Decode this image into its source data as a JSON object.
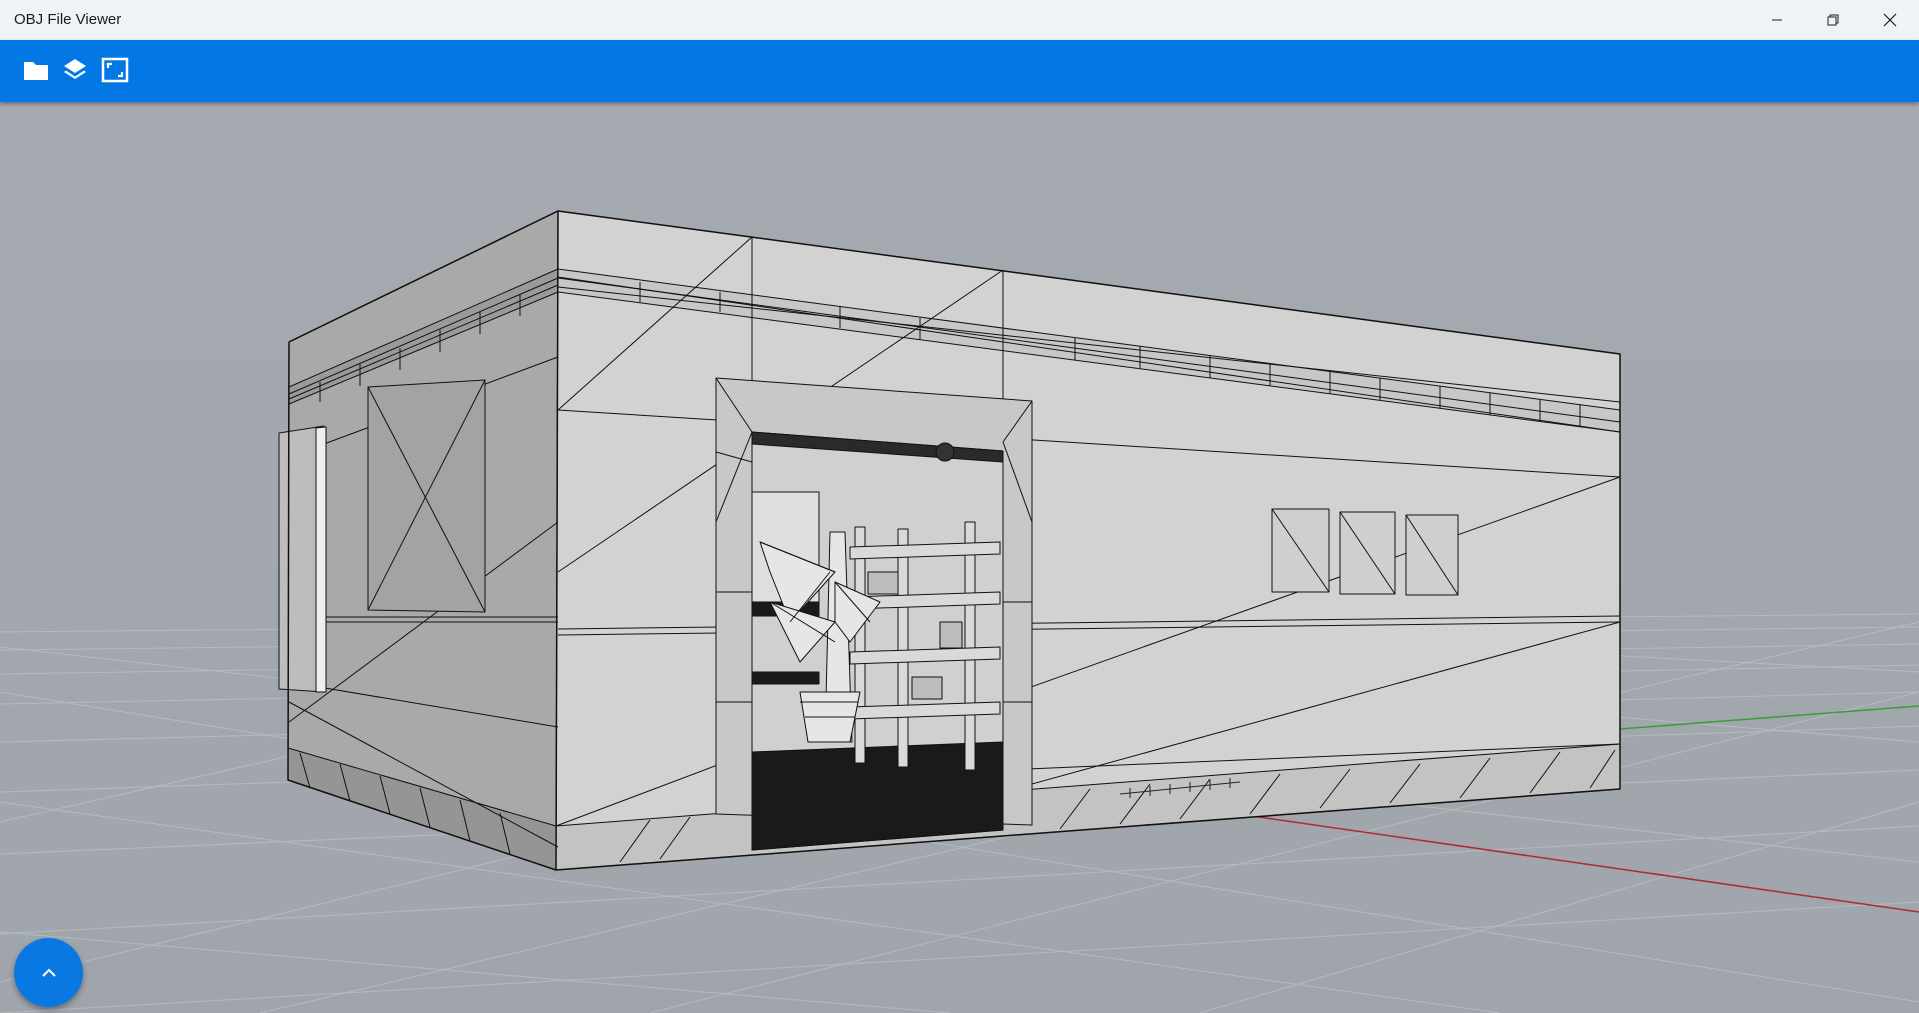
{
  "window": {
    "title": "OBJ File Viewer",
    "controls": [
      "minimize-icon",
      "restore-icon",
      "close-icon"
    ]
  },
  "toolbar": {
    "items": [
      {
        "name": "open-file-button",
        "icon": "folder-icon"
      },
      {
        "name": "layers-button",
        "icon": "layers-icon"
      },
      {
        "name": "fit-view-button",
        "icon": "fit-view-icon"
      }
    ]
  },
  "viewport": {
    "background": "#a3a8ae",
    "grid_color": "#b7bcc1",
    "axis_x_color": "#b02a2a",
    "axis_y_color": "#3c9a3c"
  },
  "fab": {
    "icon": "chevron-up-icon"
  },
  "colors": {
    "toolbar": "#0378e4",
    "titlebar": "#eff3f8",
    "fab": "#0a78e2"
  }
}
